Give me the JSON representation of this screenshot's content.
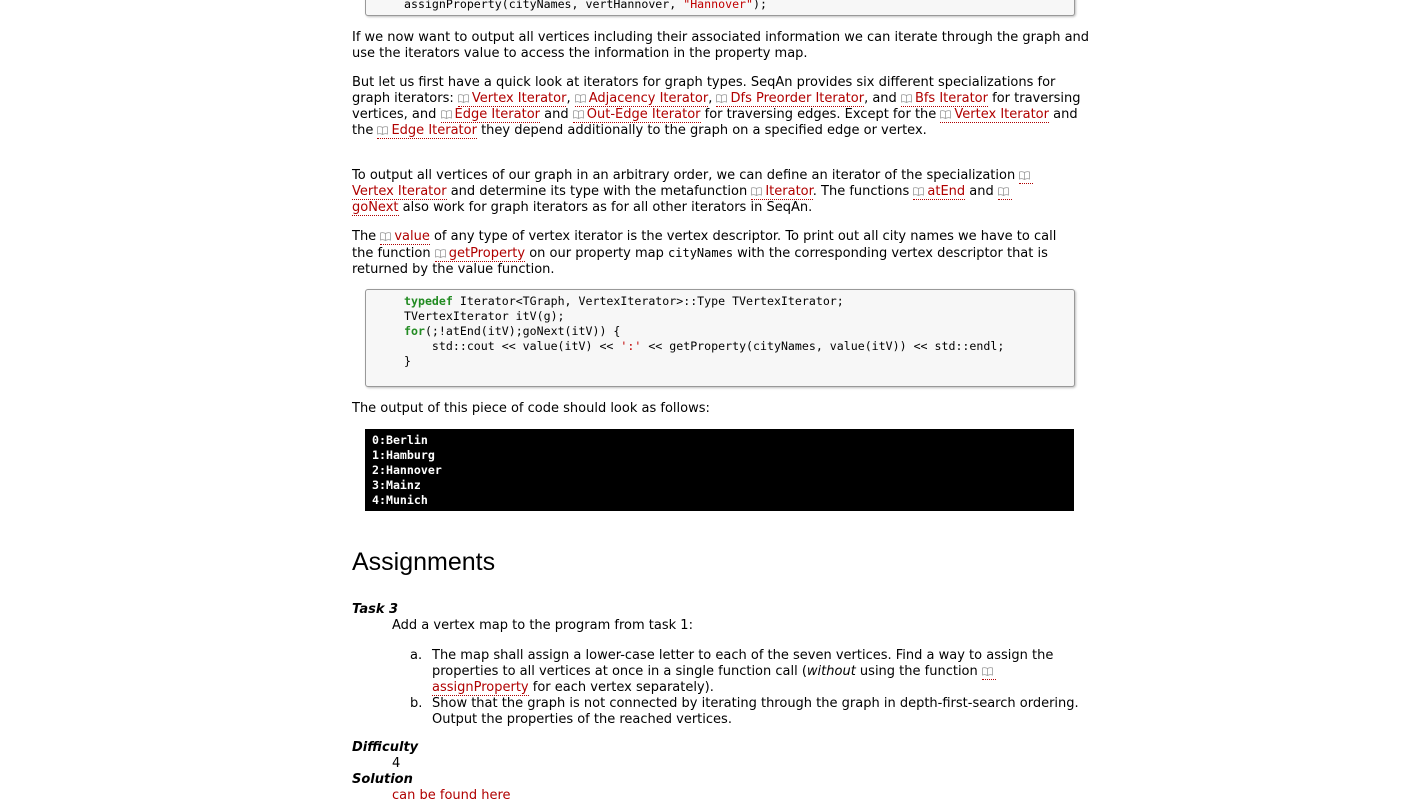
{
  "code_top": {
    "fn": "assignProperty",
    "args": "(cityNames, vertHannover, ",
    "str": "\"Hannover\"",
    "end": ");"
  },
  "para1": "If we now want to output all vertices including their associated information we can iterate through the graph and use the iterators value to access the information in the property map.",
  "para2": {
    "t1": "But let us first have a quick look at iterators for graph types. SeqAn provides six different specializations for graph iterators: ",
    "l1": "Vertex Iterator",
    "t2": ", ",
    "l2": "Adjacency Iterator",
    "t3": ", ",
    "l3": "Dfs Preorder Iterator",
    "t4": ", and ",
    "l4": "Bfs Iterator",
    "t5": " for traversing vertices, and ",
    "l5": "Edge Iterator",
    "t6": " and ",
    "l6": "Out-Edge Iterator",
    "t7": " for traversing edges. Except for the ",
    "l7": "Vertex Iterator",
    "t8": " and the ",
    "l8": "Edge Iterator",
    "t9": " they depend additionally to the graph on a specified edge or vertex."
  },
  "para3": {
    "t1": "To output all vertices of our graph in an arbitrary order, we can define an iterator of the specialization ",
    "l1": "Vertex Iterator",
    "t2": " and determine its type with the metafunction ",
    "l2": "Iterator",
    "t3": ". The functions ",
    "l3": "atEnd",
    "t4": " and ",
    "l4": "goNext",
    "t5": " also work for graph iterators as for all other iterators in SeqAn."
  },
  "para4": {
    "t1": "The ",
    "l1": "value",
    "t2": " of any type of vertex iterator is the vertex descriptor. To print out all city names we have to call the function ",
    "l2": "getProperty",
    "t3": " on our property map ",
    "code": "cityNames",
    "t4": " with the corresponding vertex descriptor that is returned by the value function."
  },
  "code_block": {
    "l1_kw": "typedef",
    "l1_rest": " Iterator<TGraph, VertexIterator>::Type TVertexIterator;",
    "l2": "TVertexIterator itV(g);",
    "l3_kw": "for",
    "l3_rest": "(;!atEnd(itV);goNext(itV)) {",
    "l4_a": "    std::cout << value(itV) << ",
    "l4_str": "':'",
    "l4_b": " << getProperty(cityNames, value(itV)) << std::endl;",
    "l5": "}"
  },
  "para5": "The output of this piece of code should look as follows:",
  "console_lines": [
    "0:Berlin",
    "1:Hamburg",
    "2:Hannover",
    "3:Mainz",
    "4:Munich"
  ],
  "assignments_heading": "Assignments",
  "task": {
    "label": "Task 3",
    "intro": "Add a vertex map to the program from task 1:",
    "items": [
      {
        "marker": "a.",
        "t1": "The map shall assign a lower-case letter to each of the seven vertices. Find a way to assign the properties to all vertices at once in a single function call (",
        "em": "without",
        "t2": " using the function ",
        "link": "assignProperty",
        "t3": " for each vertex separately)."
      },
      {
        "marker": "b.",
        "text": "Show that the graph is not connected by iterating through the graph in depth-first-search ordering. Output the properties of the reached vertices."
      }
    ],
    "difficulty_label": "Difficulty",
    "difficulty_value": "4",
    "solution_label": "Solution",
    "solution_link": "can be found here"
  },
  "colors": {
    "link": "#b00000",
    "keyword": "#228b22",
    "string": "#c00000",
    "console_bg": "#000000"
  },
  "icons": {
    "doc_link": "open-book-icon"
  }
}
